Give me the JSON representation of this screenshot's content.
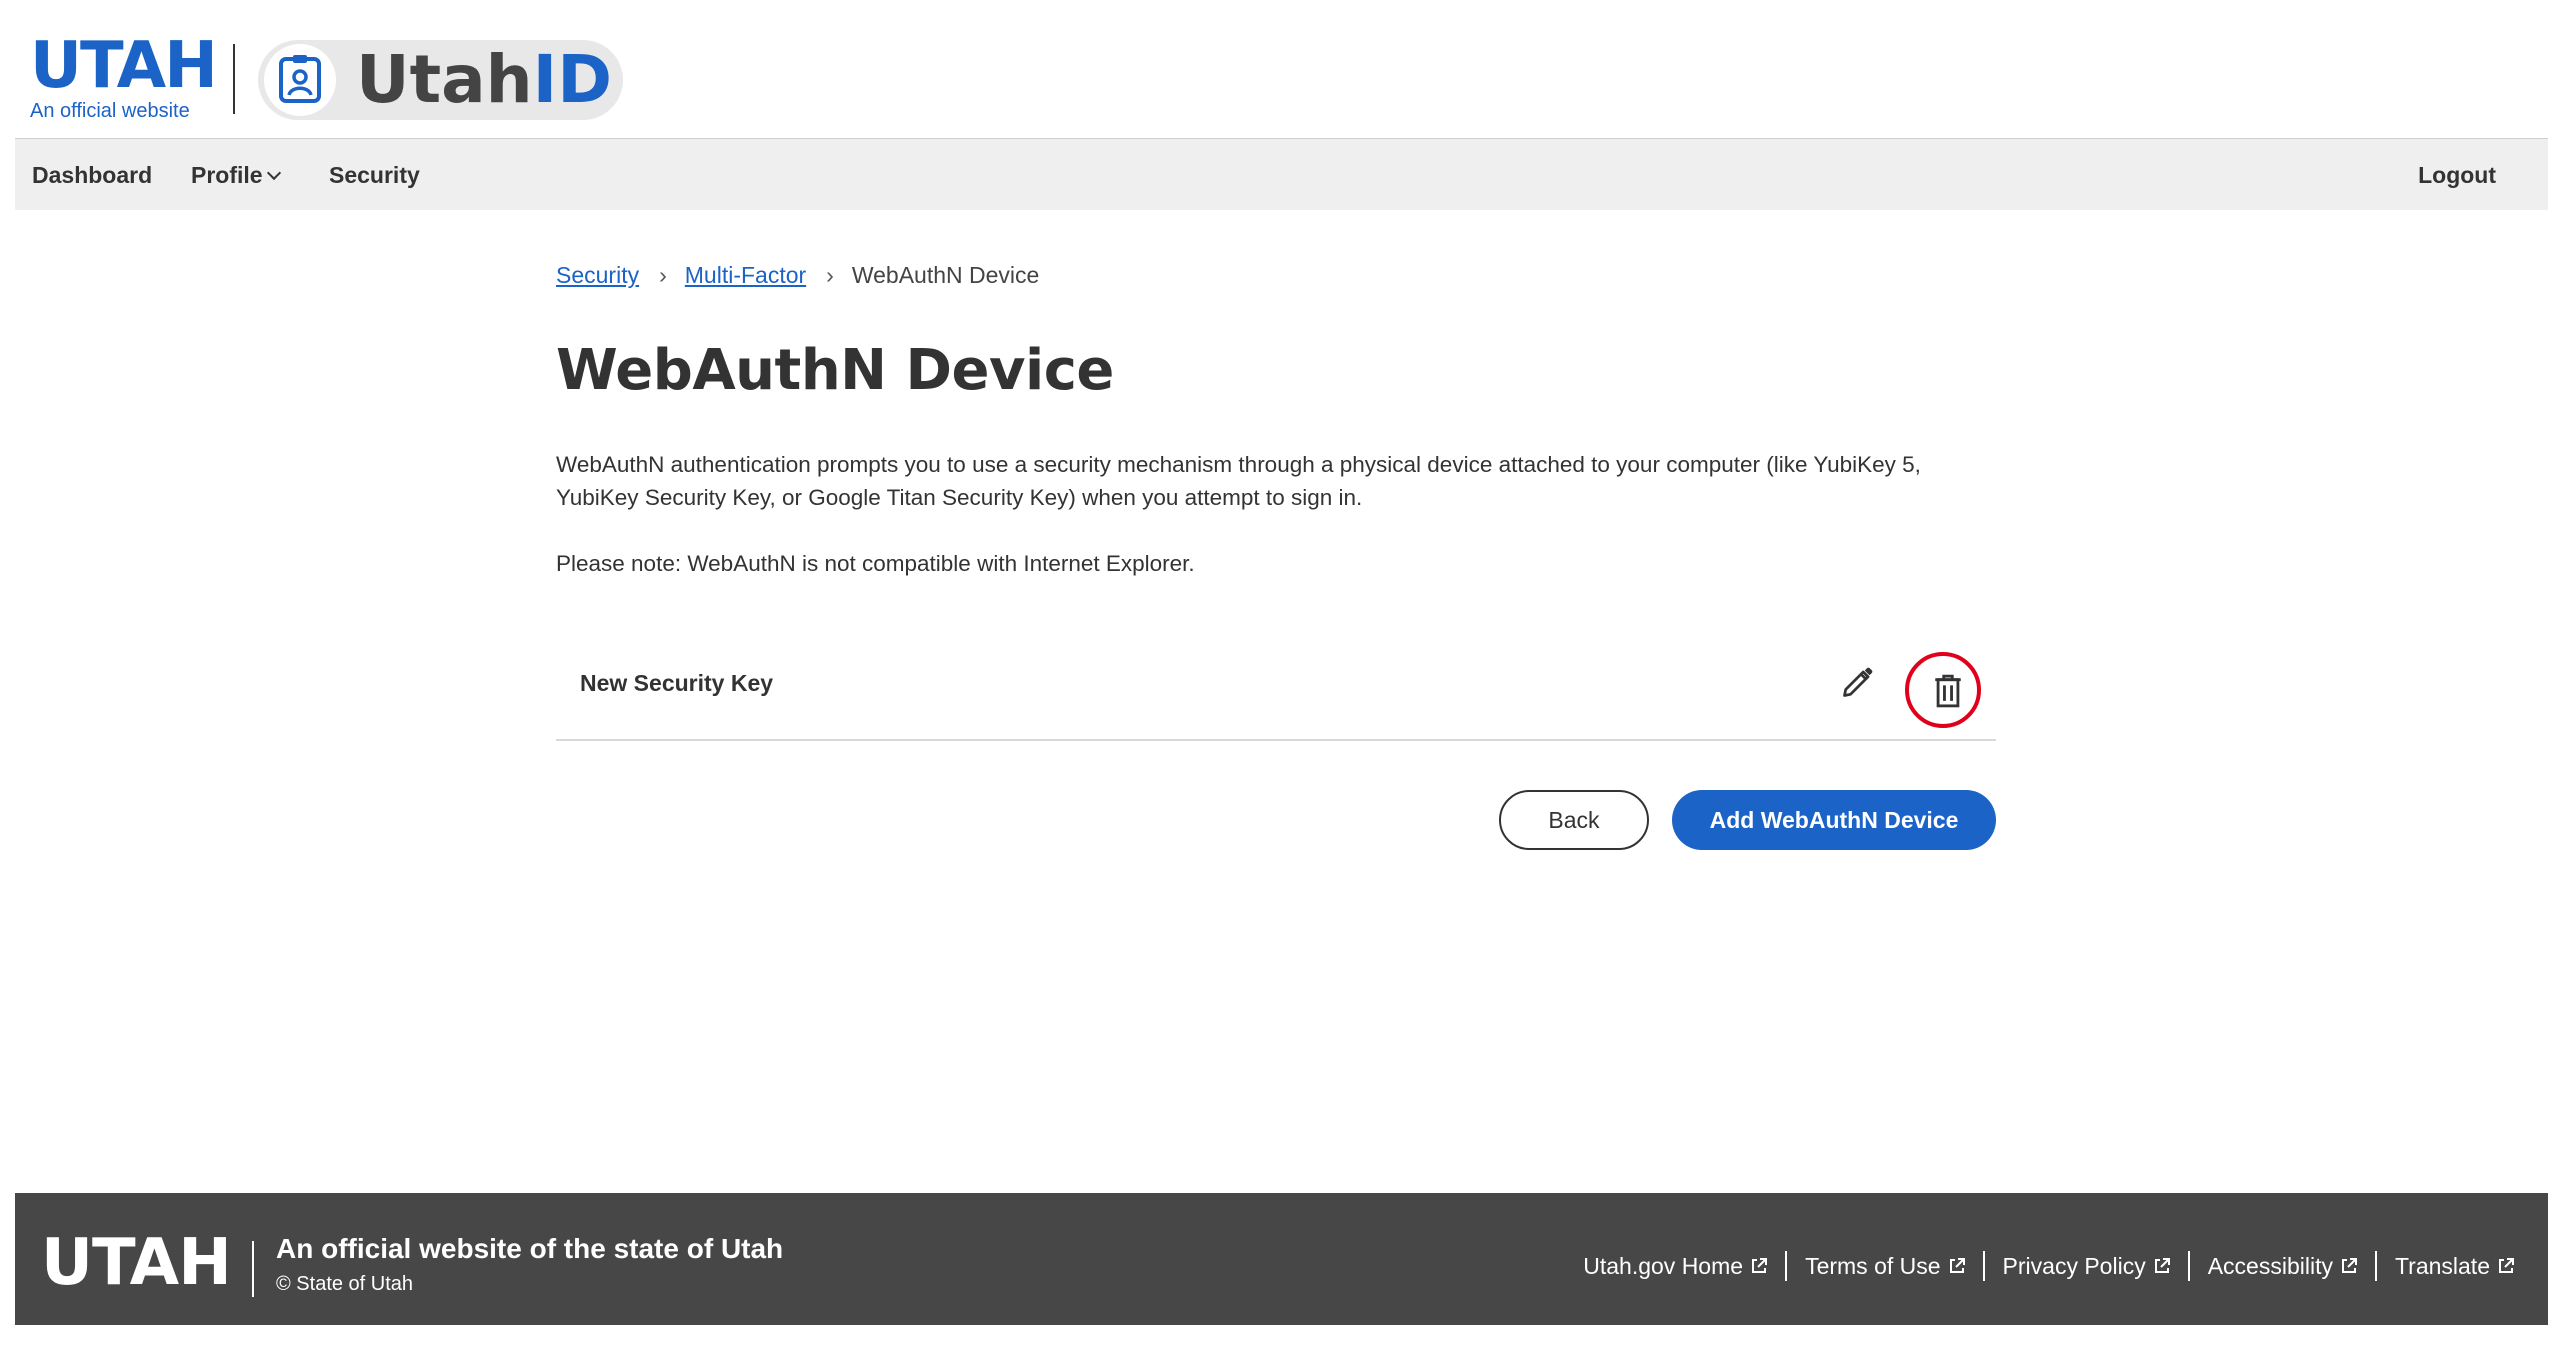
{
  "header": {
    "logo_word": "UTAH",
    "logo_sub": "An official website",
    "product_a": "Utah",
    "product_b": "ID"
  },
  "nav": {
    "dashboard": "Dashboard",
    "profile": "Profile",
    "security": "Security",
    "logout": "Logout"
  },
  "breadcrumb": {
    "items": [
      {
        "label": "Security"
      },
      {
        "label": "Multi-Factor"
      }
    ],
    "separator": "›",
    "current": "WebAuthN Device"
  },
  "page": {
    "title": "WebAuthN Device",
    "description": "WebAuthN authentication prompts you to use a security mechanism through a physical device attached to your computer (like YubiKey 5, YubiKey Security Key, or Google Titan Security Key) when you attempt to sign in.",
    "note": "Please note: WebAuthN is not compatible with Internet Explorer."
  },
  "device": {
    "name": "New Security Key",
    "edit_icon": "pencil-icon",
    "delete_icon": "trash-icon"
  },
  "actions": {
    "back": "Back",
    "add": "Add WebAuthN Device"
  },
  "footer": {
    "logo_word": "UTAH",
    "official": "An official website of the state of Utah",
    "copyright": "© State of Utah",
    "links": [
      {
        "label": "Utah.gov Home"
      },
      {
        "label": "Terms of Use"
      },
      {
        "label": "Privacy Policy"
      },
      {
        "label": "Accessibility"
      },
      {
        "label": "Translate"
      }
    ]
  },
  "colors": {
    "brand_blue": "#1b63c6",
    "highlight_red": "#e0001b",
    "footer_bg": "#474747",
    "nav_bg": "#efefef"
  }
}
